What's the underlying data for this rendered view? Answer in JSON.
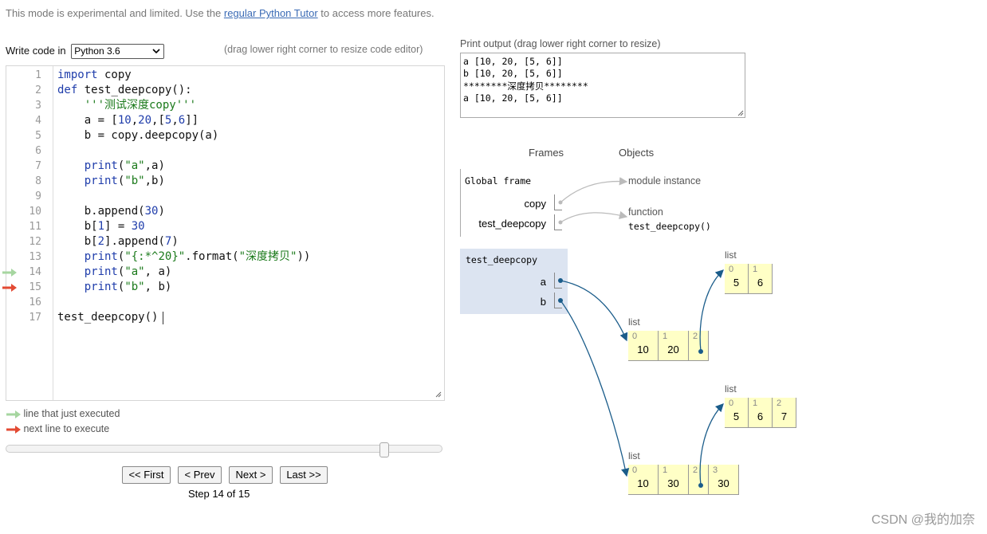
{
  "notice": {
    "before": "This mode is experimental and limited. Use the ",
    "link": "regular Python Tutor",
    "after": " to access more features."
  },
  "editor_panel": {
    "write_label": "Write code in",
    "language": "Python 3.6",
    "resize_hint": "(drag lower right corner to resize code editor)"
  },
  "code_lines": [
    {
      "n": "1",
      "segs": [
        {
          "t": "import",
          "c": "kw"
        },
        {
          "t": " copy",
          "c": ""
        }
      ]
    },
    {
      "n": "2",
      "segs": [
        {
          "t": "def",
          "c": "kw"
        },
        {
          "t": " test_deepcopy():",
          "c": ""
        }
      ]
    },
    {
      "n": "3",
      "segs": [
        {
          "t": "    '''测试深度copy'''",
          "c": "str"
        }
      ]
    },
    {
      "n": "4",
      "segs": [
        {
          "t": "    a = [",
          "c": ""
        },
        {
          "t": "10",
          "c": "num"
        },
        {
          "t": ",",
          "c": ""
        },
        {
          "t": "20",
          "c": "num"
        },
        {
          "t": ",[",
          "c": ""
        },
        {
          "t": "5",
          "c": "num"
        },
        {
          "t": ",",
          "c": ""
        },
        {
          "t": "6",
          "c": "num"
        },
        {
          "t": "]]",
          "c": ""
        }
      ]
    },
    {
      "n": "5",
      "segs": [
        {
          "t": "    b = copy.deepcopy(a)",
          "c": ""
        }
      ]
    },
    {
      "n": "6",
      "segs": []
    },
    {
      "n": "7",
      "segs": [
        {
          "t": "    ",
          "c": ""
        },
        {
          "t": "print",
          "c": "kw"
        },
        {
          "t": "(",
          "c": ""
        },
        {
          "t": "\"a\"",
          "c": "str"
        },
        {
          "t": ",a)",
          "c": ""
        }
      ]
    },
    {
      "n": "8",
      "segs": [
        {
          "t": "    ",
          "c": ""
        },
        {
          "t": "print",
          "c": "kw"
        },
        {
          "t": "(",
          "c": ""
        },
        {
          "t": "\"b\"",
          "c": "str"
        },
        {
          "t": ",b)",
          "c": ""
        }
      ]
    },
    {
      "n": "9",
      "segs": []
    },
    {
      "n": "10",
      "segs": [
        {
          "t": "    b.append(",
          "c": ""
        },
        {
          "t": "30",
          "c": "num"
        },
        {
          "t": ")",
          "c": ""
        }
      ]
    },
    {
      "n": "11",
      "segs": [
        {
          "t": "    b[",
          "c": ""
        },
        {
          "t": "1",
          "c": "num"
        },
        {
          "t": "] = ",
          "c": ""
        },
        {
          "t": "30",
          "c": "num"
        }
      ]
    },
    {
      "n": "12",
      "segs": [
        {
          "t": "    b[",
          "c": ""
        },
        {
          "t": "2",
          "c": "num"
        },
        {
          "t": "].append(",
          "c": ""
        },
        {
          "t": "7",
          "c": "num"
        },
        {
          "t": ")",
          "c": ""
        }
      ]
    },
    {
      "n": "13",
      "segs": [
        {
          "t": "    ",
          "c": ""
        },
        {
          "t": "print",
          "c": "kw"
        },
        {
          "t": "(",
          "c": ""
        },
        {
          "t": "\"{:*^20}\"",
          "c": "str"
        },
        {
          "t": ".format(",
          "c": ""
        },
        {
          "t": "\"深度拷贝\"",
          "c": "str"
        },
        {
          "t": "))",
          "c": ""
        }
      ]
    },
    {
      "n": "14",
      "segs": [
        {
          "t": "    ",
          "c": ""
        },
        {
          "t": "print",
          "c": "kw"
        },
        {
          "t": "(",
          "c": ""
        },
        {
          "t": "\"a\"",
          "c": "str"
        },
        {
          "t": ", a)",
          "c": ""
        }
      ]
    },
    {
      "n": "15",
      "segs": [
        {
          "t": "    ",
          "c": ""
        },
        {
          "t": "print",
          "c": "kw"
        },
        {
          "t": "(",
          "c": ""
        },
        {
          "t": "\"b\"",
          "c": "str"
        },
        {
          "t": ", b)",
          "c": ""
        }
      ]
    },
    {
      "n": "16",
      "segs": []
    },
    {
      "n": "17",
      "segs": [
        {
          "t": "test_deepcopy()",
          "c": ""
        }
      ]
    }
  ],
  "arrows": {
    "just_executed_line": "14",
    "next_line": "15"
  },
  "legend": {
    "just_executed": "line that just executed",
    "next_line": "next line to execute",
    "just_executed_color": "#a6d6a0",
    "next_line_color": "#e34a33"
  },
  "step_slider": {
    "current": 14,
    "total": 15
  },
  "nav": {
    "first": "<< First",
    "prev": "< Prev",
    "next": "Next >",
    "last": "Last >>"
  },
  "step_text": "Step 14 of 15",
  "output": {
    "label": "Print output (drag lower right corner to resize)",
    "lines": [
      "a [10, 20, [5, 6]]",
      "b [10, 20, [5, 6]]",
      "********深度拷贝********",
      "a [10, 20, [5, 6]]"
    ]
  },
  "viz": {
    "frames_header": "Frames",
    "objects_header": "Objects",
    "global_frame": {
      "title": "Global frame",
      "vars": [
        "copy",
        "test_deepcopy"
      ]
    },
    "module_obj": "module instance",
    "function_obj": {
      "type": "function",
      "name": "test_deepcopy()"
    },
    "local_frame": {
      "title": "test_deepcopy",
      "vars": [
        "a",
        "b"
      ]
    },
    "lists": {
      "type_label": "list",
      "inner_a": {
        "idx": [
          "0",
          "1"
        ],
        "vals": [
          "5",
          "6"
        ]
      },
      "outer_a": {
        "idx": [
          "0",
          "1",
          "2"
        ],
        "vals": [
          "10",
          "20",
          ""
        ]
      },
      "inner_b": {
        "idx": [
          "0",
          "1",
          "2"
        ],
        "vals": [
          "5",
          "6",
          "7"
        ]
      },
      "outer_b": {
        "idx": [
          "0",
          "1",
          "2",
          "3"
        ],
        "vals": [
          "10",
          "30",
          "",
          "30"
        ]
      }
    },
    "pointer_color": "#1a5c8a",
    "frame_bg": "#dce4f1",
    "list_bg": "#ffffc6"
  },
  "watermark": "CSDN @我的加奈"
}
